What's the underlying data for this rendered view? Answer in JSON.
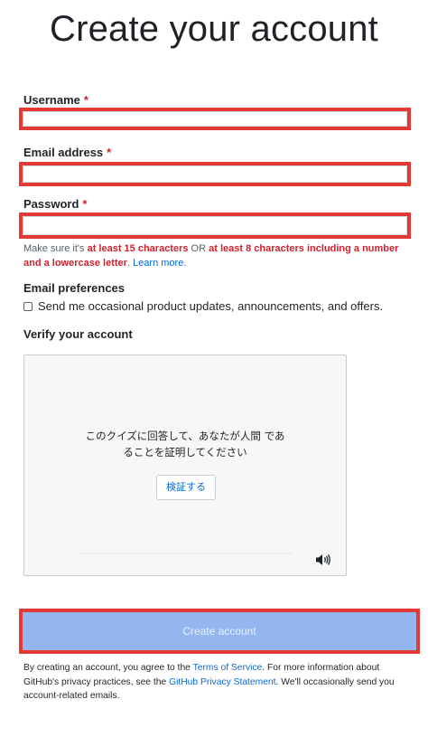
{
  "page": {
    "title": "Create your account"
  },
  "form": {
    "username": {
      "label": "Username",
      "required_mark": "*",
      "value": "",
      "placeholder": ""
    },
    "email": {
      "label": "Email address",
      "required_mark": "*",
      "value": "",
      "placeholder": ""
    },
    "password": {
      "label": "Password",
      "required_mark": "*",
      "value": "",
      "placeholder": "",
      "hint_prefix": "Make sure it's ",
      "hint_part1": "at least 15 characters",
      "hint_or": " OR ",
      "hint_part2": "at least 8 characters including a number and a lowercase letter",
      "hint_period": ". ",
      "hint_link": "Learn more."
    },
    "preferences": {
      "label": "Email preferences",
      "checkbox_label": "Send me occasional product updates, announcements, and offers.",
      "checked": false
    },
    "verify": {
      "label": "Verify your account",
      "prompt_line1": "このクイズに回答して、あなたが人間 であ",
      "prompt_line2": "ることを証明してください",
      "button_label": "検証する",
      "audio_icon": "speaker-icon"
    },
    "submit": {
      "label": "Create account",
      "disabled": true
    }
  },
  "legal": {
    "text1": "By creating an account, you agree to the ",
    "terms_link": "Terms of Service",
    "text2": ". For more information about GitHub's privacy practices, see the ",
    "privacy_link": "GitHub Privacy Statement",
    "text3": ". We'll occasionally send you account-related emails."
  },
  "colors": {
    "highlight_border": "#e53935",
    "required": "#cf222e",
    "link": "#0969da",
    "submit_bg": "#94b6ee"
  }
}
